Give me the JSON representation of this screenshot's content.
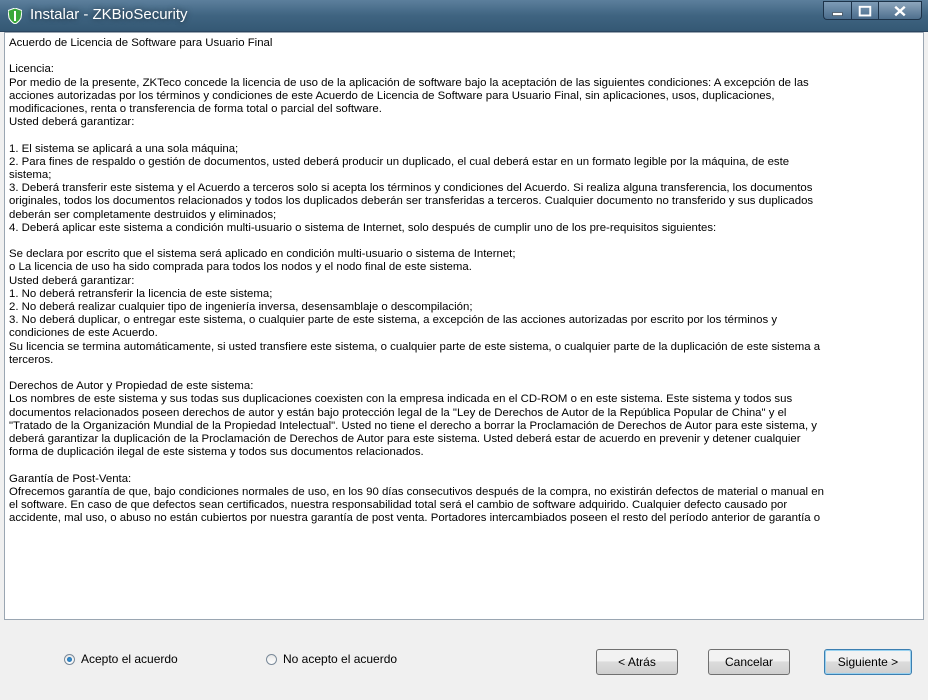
{
  "window": {
    "title": "Instalar - ZKBioSecurity",
    "icon": "shield-icon",
    "controls": [
      "minimize-icon",
      "maximize-icon",
      "close-icon"
    ]
  },
  "license": {
    "paragraphs": [
      "Acuerdo de Licencia de Software para Usuario Final",
      "Licencia:\nPor medio de la presente, ZKTeco concede la licencia de uso de la aplicación de software bajo la aceptación de las siguientes condiciones: A excepción de las\nacciones autorizadas por los términos y condiciones de este Acuerdo de Licencia de Software para Usuario Final, sin aplicaciones, usos, duplicaciones,\nmodificaciones, renta o transferencia de forma total o parcial del software.\nUsted deberá garantizar:",
      "1. El sistema se aplicará a una sola máquina;\n2. Para fines de respaldo o gestión de documentos, usted deberá producir un duplicado, el cual deberá estar en un formato legible por la máquina, de este\nsistema;\n3. Deberá transferir este sistema y el Acuerdo a terceros solo si acepta los términos y condiciones del Acuerdo. Si realiza alguna transferencia, los documentos\noriginales, todos los documentos relacionados y todos los duplicados deberán ser transferidas a terceros. Cualquier documento no transferido y sus duplicados\ndeberán ser completamente destruidos y eliminados;\n4. Deberá aplicar este sistema a condición multi-usuario o sistema de Internet, solo después de cumplir uno de los pre-requisitos siguientes:",
      "Se declara por escrito que el sistema será aplicado en condición multi-usuario o sistema de Internet;\no La licencia de uso ha sido comprada para todos los nodos y el nodo final de este sistema.\nUsted deberá garantizar:\n1. No deberá retransferir la licencia de este sistema;\n2. No deberá realizar cualquier tipo de ingeniería inversa, desensamblaje o descompilación;\n3. No deberá duplicar, o entregar este sistema, o cualquier parte de este sistema, a excepción de las acciones autorizadas por escrito por los términos y\ncondiciones de este Acuerdo.\nSu licencia se termina automáticamente, si usted transfiere este sistema, o cualquier parte de este sistema, o cualquier parte de la duplicación de este sistema a\nterceros.",
      "Derechos de Autor y Propiedad de este sistema:\nLos nombres de este sistema y sus todas sus duplicaciones coexisten con la empresa indicada en el CD-ROM o en este sistema. Este sistema y todos sus\ndocumentos relacionados poseen derechos de autor y están bajo protección legal de la \"Ley de Derechos de Autor de la República Popular de China\" y el\n\"Tratado de la Organización Mundial de la Propiedad Intelectual\". Usted no tiene el derecho a borrar la Proclamación de Derechos de Autor para este sistema, y\ndeberá garantizar la duplicación de la Proclamación de Derechos de Autor para este sistema. Usted deberá estar de acuerdo en prevenir y detener cualquier\nforma de duplicación ilegal de este sistema y todos sus documentos relacionados.",
      "Garantía de Post-Venta:\nOfrecemos garantía de que, bajo condiciones normales de uso, en los 90 días consecutivos después de la compra, no existirán defectos de material o manual en\nel software. En caso de que defectos sean certificados, nuestra responsabilidad total será el cambio de software adquirido. Cualquier defecto causado por\naccidente, mal uso, o abuso no están cubiertos por nuestra garantía de post venta. Portadores intercambiados poseen el resto del período anterior de garantía o"
    ]
  },
  "options": {
    "accept": "Acepto el acuerdo",
    "decline": "No acepto el acuerdo",
    "selected": "accept"
  },
  "buttons": {
    "back": "< Atrás",
    "cancel": "Cancelar",
    "next": "Siguiente >"
  }
}
